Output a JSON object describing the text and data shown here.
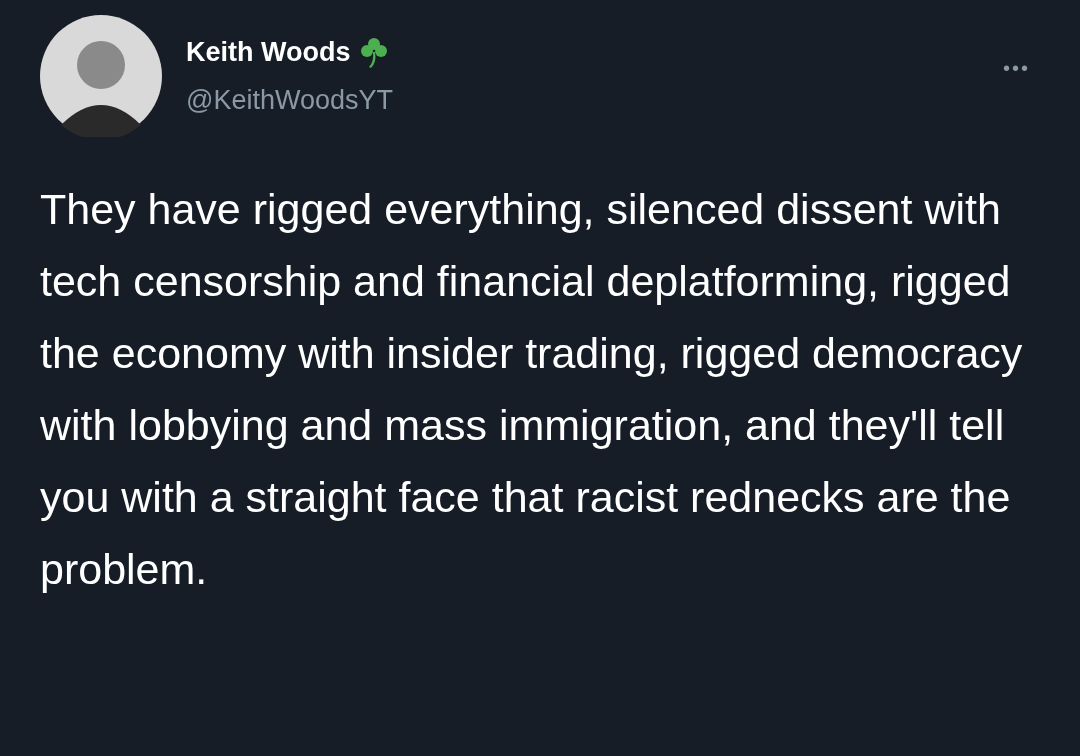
{
  "author": {
    "name": "Keith Woods",
    "handle": "@KeithWoodsYT"
  },
  "more": "•••",
  "tweet": {
    "text": "They have rigged everything, silenced dissent with tech censorship and financial deplatforming, rigged the economy with insider trading, rigged democracy with lobbying and mass immigration, and they'll tell you with a straight face that racist rednecks are the problem."
  }
}
